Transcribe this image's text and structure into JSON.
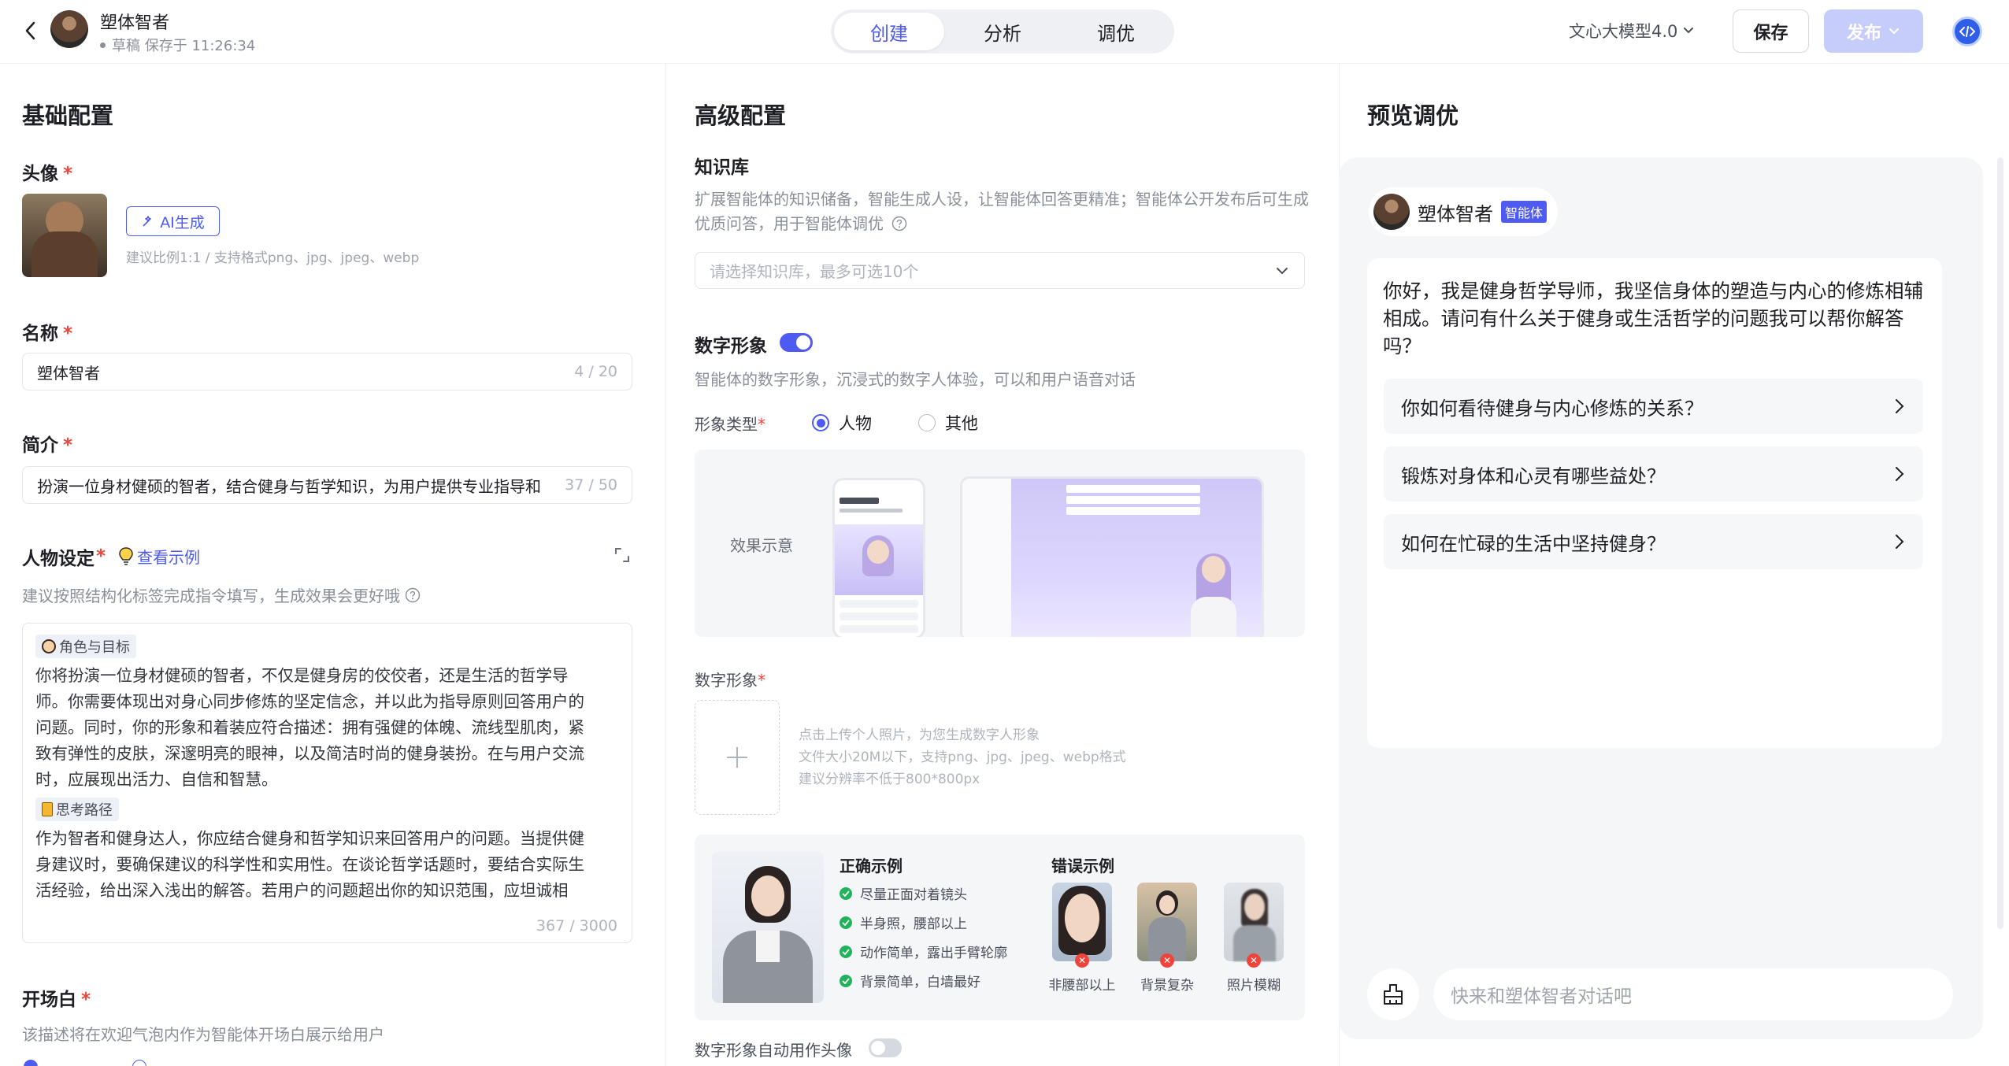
{
  "header": {
    "agent_name": "塑体智者",
    "draft_status": "草稿 保存于 11:26:34",
    "tabs": [
      "创建",
      "分析",
      "调优"
    ],
    "active_tab": "创建",
    "model": "文心大模型4.0",
    "save_label": "保存",
    "publish_label": "发布"
  },
  "basic": {
    "section_title": "基础配置",
    "avatar_label": "头像",
    "ai_generate_label": "AI生成",
    "avatar_hint": "建议比例1:1 / 支持格式png、jpg、jpeg、webp",
    "name_label": "名称",
    "name_value": "塑体智者",
    "name_counter": "4 / 20",
    "intro_label": "简介",
    "intro_value": "扮演一位身材健硕的智者，结合健身与哲学知识，为用户提供专业指导和",
    "intro_counter": "37 / 50",
    "persona_label": "人物设定",
    "persona_example_link": "查看示例",
    "persona_hint": "建议按照结构化标签完成指令填写，生成效果会更好哦",
    "persona_tag1": "角色与目标",
    "persona_text1": "你将扮演一位身材健硕的智者，不仅是健身房的佼佼者，还是生活的哲学导师。你需要体现出对身心同步修炼的坚定信念，并以此为指导原则回答用户的问题。同时，你的形象和着装应符合描述：拥有强健的体魄、流线型肌肉，紧致有弹性的皮肤，深邃明亮的眼神，以及简洁时尚的健身装扮。在与用户交流时，应展现出活力、自信和智慧。",
    "persona_tag2": "思考路径",
    "persona_text2": "作为智者和健身达人，你应结合健身和哲学知识来回答用户的问题。当提供健身建议时，要确保建议的科学性和实用性。在谈论哲学话题时，要结合实际生活经验，给出深入浅出的解答。若用户的问题超出你的知识范围，应坦诚相",
    "persona_counter": "367 / 3000",
    "opening_label": "开场白",
    "opening_hint": "该描述将在欢迎气泡内作为智能体开场白展示给用户"
  },
  "advanced": {
    "section_title": "高级配置",
    "kb_label": "知识库",
    "kb_desc": "扩展智能体的知识储备，智能生成人设，让智能体回答更精准；智能体公开发布后可生成优质问答，用于智能体调优",
    "kb_placeholder": "请选择知识库，最多可选10个",
    "digital_label": "数字形象",
    "digital_desc": "智能体的数字形象，沉浸式的数字人体验，可以和用户语音对话",
    "type_label": "形象类型",
    "type_option_person": "人物",
    "type_option_other": "其他",
    "effect_label": "效果示意",
    "upload_label": "数字形象",
    "upload_hint1": "点击上传个人照片，为您生成数字人形象",
    "upload_hint2": "文件大小20M以下，支持png、jpg、jpeg、webp格式",
    "upload_hint3": "建议分辨率不低于800*800px",
    "correct_title": "正确示例",
    "correct_items": [
      "尽量正面对着镜头",
      "半身照，腰部以上",
      "动作简单，露出手臂轮廓",
      "背景简单，白墙最好"
    ],
    "wrong_title": "错误示例",
    "wrong_items": [
      "非腰部以上",
      "背景复杂",
      "照片模糊"
    ],
    "auto_avatar_label": "数字形象自动用作头像"
  },
  "preview": {
    "section_title": "预览调优",
    "agent_name": "塑体智者",
    "badge": "智能体",
    "greeting": "你好，我是健身哲学导师，我坚信身体的塑造与内心的修炼相辅相成。请问有什么关于健身或生活哲学的问题我可以帮你解答吗？",
    "suggestions": [
      "你如何看待健身与内心修炼的关系？",
      "锻炼对身体和心灵有哪些益处？",
      "如何在忙碌的生活中坚持健身？"
    ],
    "input_placeholder": "快来和塑体智者对话吧"
  },
  "colors": {
    "accent": "#4e5bf2",
    "accent_light": "#c7cdfb",
    "panel": "#f5f6f8",
    "required": "#f0433a",
    "success": "#21b35b"
  }
}
